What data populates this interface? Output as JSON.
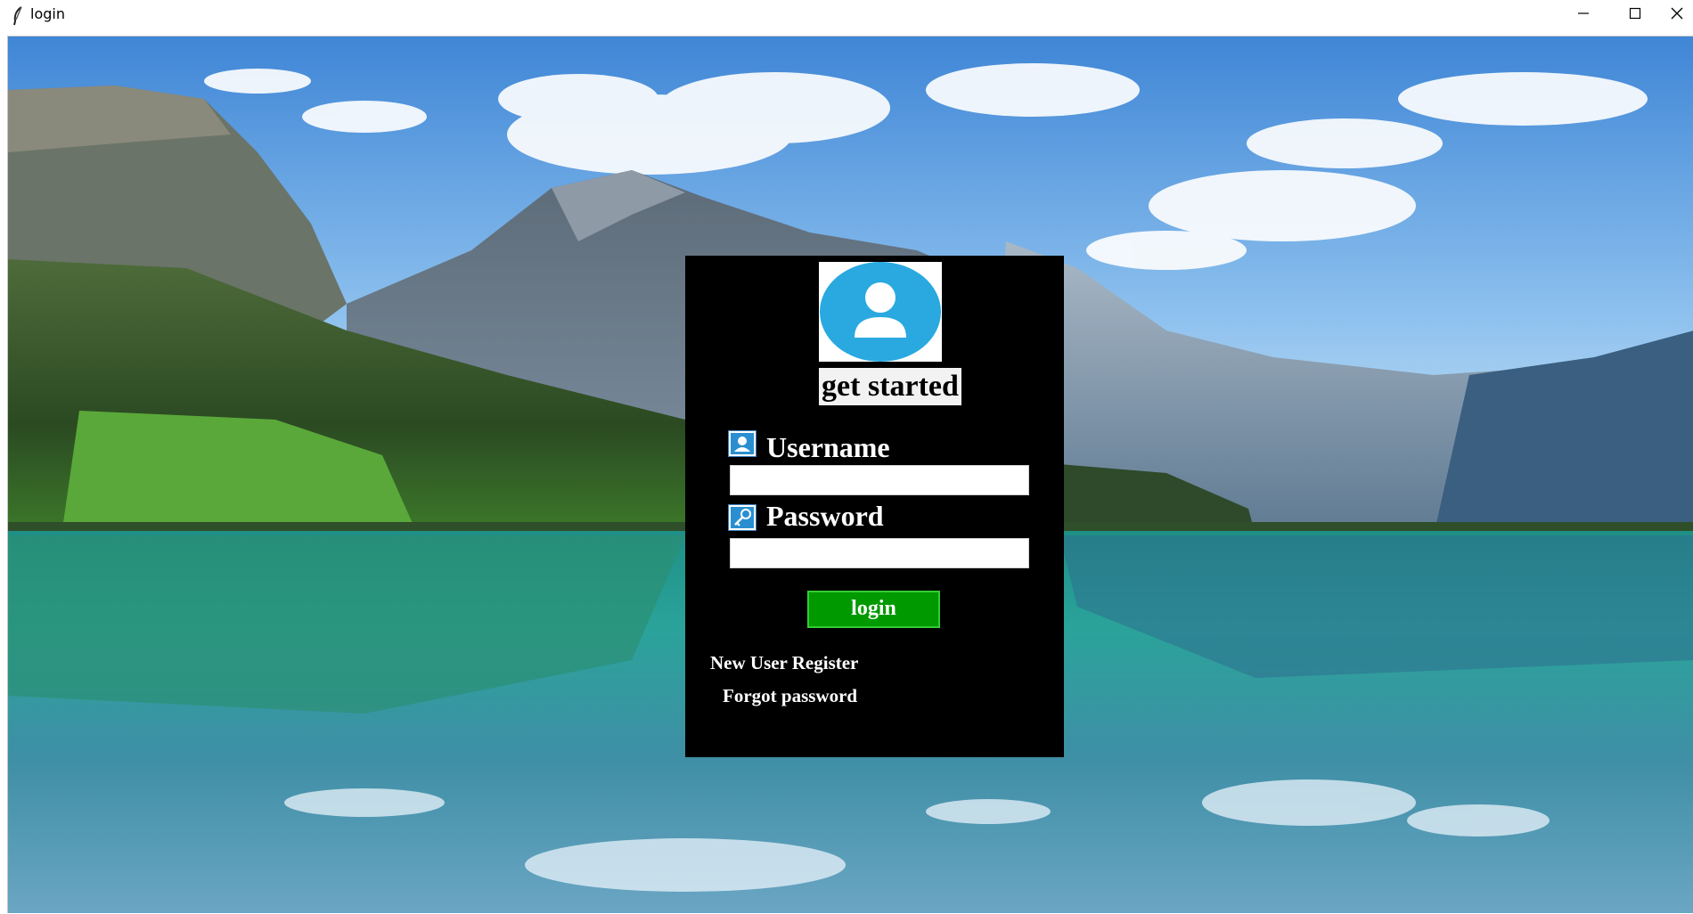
{
  "window": {
    "title": "login",
    "controls": {
      "minimize_icon": "minimize-icon",
      "maximize_icon": "maximize-icon",
      "close_icon": "close-icon"
    }
  },
  "login_panel": {
    "avatar_icon": "user-avatar-icon",
    "heading": "get started",
    "username": {
      "label": "Username",
      "icon": "user-id-icon",
      "value": ""
    },
    "password": {
      "label": "Password",
      "icon": "key-icon",
      "value": ""
    },
    "login_button": "login",
    "register_link": "New User Register",
    "forgot_link": "Forgot password"
  },
  "colors": {
    "panel_bg": "#000000",
    "button_green": "#009900",
    "avatar_blue": "#29a9e0"
  }
}
